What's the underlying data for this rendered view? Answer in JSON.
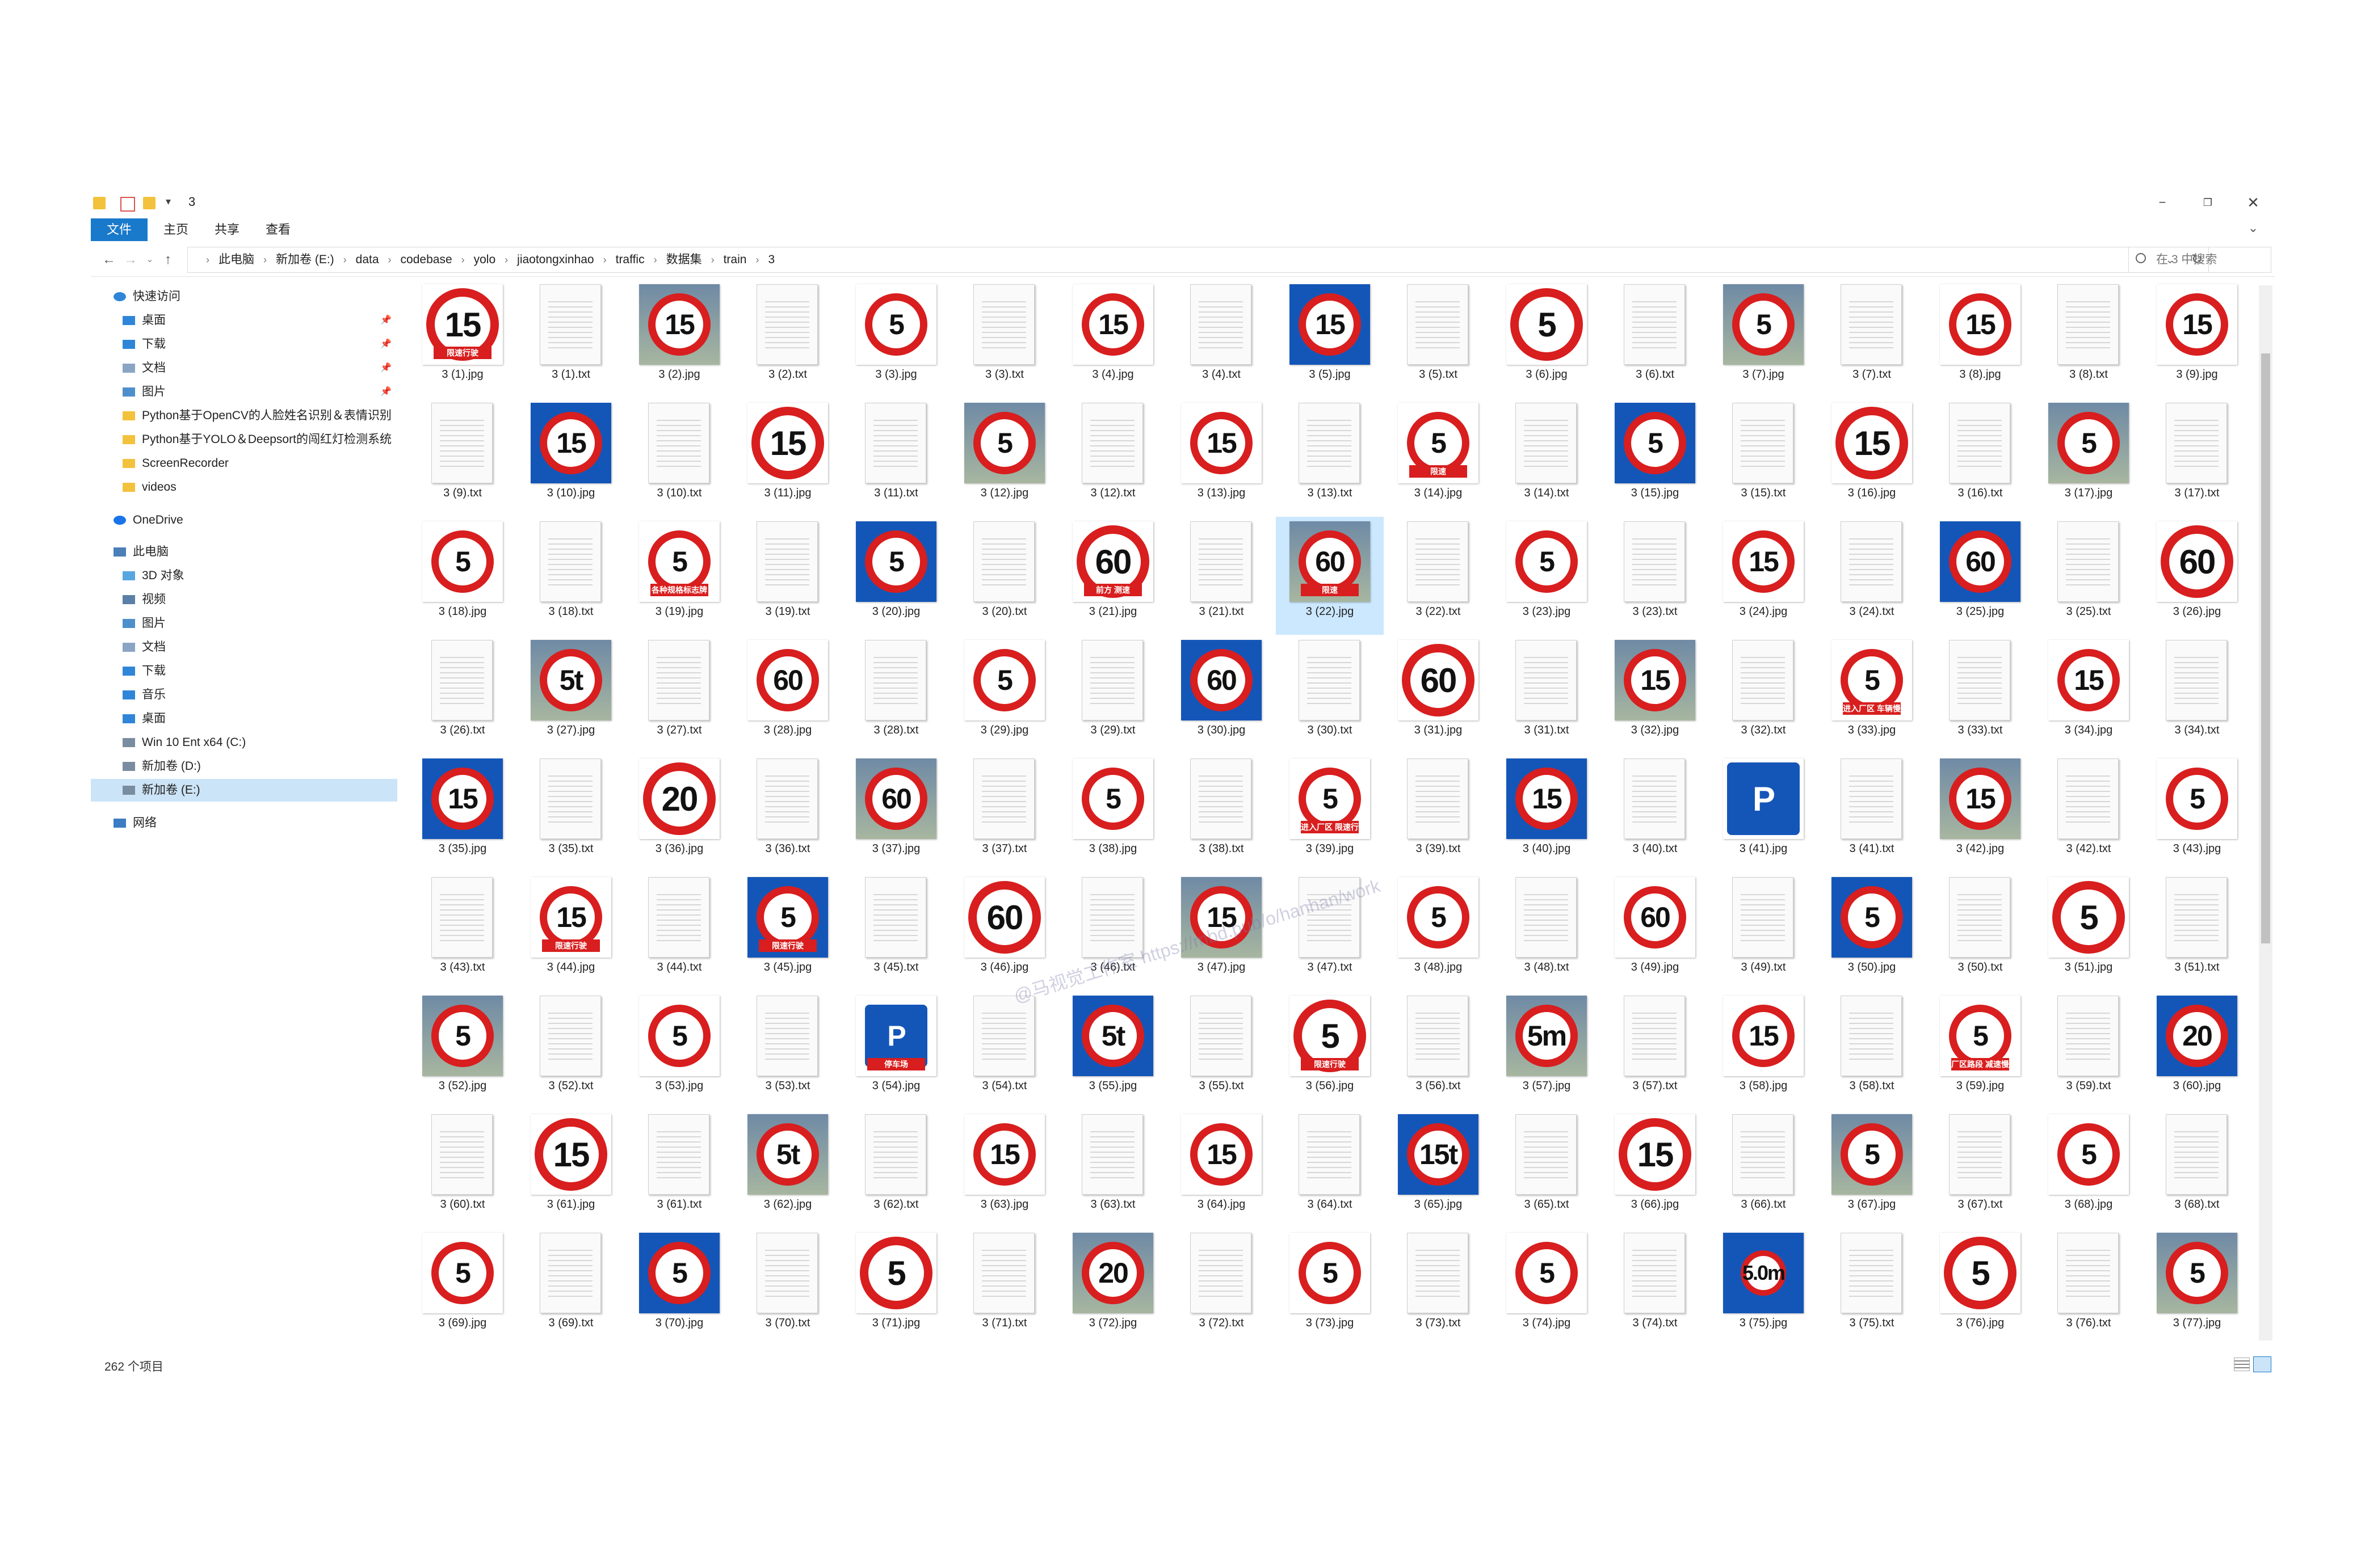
{
  "window": {
    "title": "3",
    "minimize": "−",
    "maximize": "❐",
    "close": "✕"
  },
  "ribbon": {
    "tabs": [
      "文件",
      "主页",
      "共享",
      "查看"
    ],
    "expand": "⌄"
  },
  "nav": {
    "back": "←",
    "forward": "→",
    "recent": "⌄",
    "up": "↑"
  },
  "address": {
    "crumbs": [
      "此电脑",
      "新加卷 (E:)",
      "data",
      "codebase",
      "yolo",
      "jiaotongxinhao",
      "traffic",
      "数据集",
      "train",
      "3"
    ],
    "dropdown": "⌄",
    "refresh": "↻"
  },
  "search": {
    "placeholder": "在 3 中搜索"
  },
  "navpane": {
    "items": [
      {
        "label": "快速访问",
        "level": 0,
        "icon": "star-icon",
        "pinned": false,
        "selected": false
      },
      {
        "label": "桌面",
        "level": 1,
        "icon": "desktop-icon",
        "pinned": true,
        "selected": false
      },
      {
        "label": "下载",
        "level": 1,
        "icon": "download-icon",
        "pinned": true,
        "selected": false
      },
      {
        "label": "文档",
        "level": 1,
        "icon": "document-icon",
        "pinned": true,
        "selected": false
      },
      {
        "label": "图片",
        "level": 1,
        "icon": "picture-icon",
        "pinned": true,
        "selected": false
      },
      {
        "label": "Python基于OpenCV的人脸姓名识别＆表情识别",
        "level": 1,
        "icon": "folder-icon",
        "pinned": false,
        "selected": false
      },
      {
        "label": "Python基于YOLO＆Deepsort的闯红灯检测系统",
        "level": 1,
        "icon": "folder-icon",
        "pinned": false,
        "selected": false
      },
      {
        "label": "ScreenRecorder",
        "level": 1,
        "icon": "folder-icon",
        "pinned": false,
        "selected": false
      },
      {
        "label": "videos",
        "level": 1,
        "icon": "folder-icon",
        "pinned": false,
        "selected": false
      },
      {
        "label": "OneDrive",
        "level": 0,
        "icon": "cloud-icon",
        "pinned": false,
        "selected": false
      },
      {
        "label": "此电脑",
        "level": 0,
        "icon": "computer-icon",
        "pinned": false,
        "selected": false
      },
      {
        "label": "3D 对象",
        "level": 1,
        "icon": "cube-icon",
        "pinned": false,
        "selected": false
      },
      {
        "label": "视频",
        "level": 1,
        "icon": "video-icon",
        "pinned": false,
        "selected": false
      },
      {
        "label": "图片",
        "level": 1,
        "icon": "picture-icon",
        "pinned": false,
        "selected": false
      },
      {
        "label": "文档",
        "level": 1,
        "icon": "document-icon",
        "pinned": false,
        "selected": false
      },
      {
        "label": "下载",
        "level": 1,
        "icon": "download-icon",
        "pinned": false,
        "selected": false
      },
      {
        "label": "音乐",
        "level": 1,
        "icon": "music-icon",
        "pinned": false,
        "selected": false
      },
      {
        "label": "桌面",
        "level": 1,
        "icon": "desktop-icon",
        "pinned": false,
        "selected": false
      },
      {
        "label": "Win 10 Ent x64 (C:)",
        "level": 1,
        "icon": "drive-icon",
        "pinned": false,
        "selected": false
      },
      {
        "label": "新加卷 (D:)",
        "level": 1,
        "icon": "drive-icon",
        "pinned": false,
        "selected": false
      },
      {
        "label": "新加卷 (E:)",
        "level": 1,
        "icon": "drive-icon",
        "pinned": false,
        "selected": true
      },
      {
        "label": "网络",
        "level": 0,
        "icon": "network-icon",
        "pinned": false,
        "selected": false
      }
    ],
    "pin_glyph": "📌"
  },
  "files": [
    "3 (1).jpg",
    "3 (1).txt",
    "3 (2).jpg",
    "3 (2).txt",
    "3 (3).jpg",
    "3 (3).txt",
    "3 (4).jpg",
    "3 (4).txt",
    "3 (5).jpg",
    "3 (5).txt",
    "3 (6).jpg",
    "3 (6).txt",
    "3 (7).jpg",
    "3 (7).txt",
    "3 (8).jpg",
    "3 (8).txt",
    "3 (9).jpg",
    "3 (9).txt",
    "3 (10).jpg",
    "3 (10).txt",
    "3 (11).jpg",
    "3 (11).txt",
    "3 (12).jpg",
    "3 (12).txt",
    "3 (13).jpg",
    "3 (13).txt",
    "3 (14).jpg",
    "3 (14).txt",
    "3 (15).jpg",
    "3 (15).txt",
    "3 (16).jpg",
    "3 (16).txt",
    "3 (17).jpg",
    "3 (17).txt",
    "3 (18).jpg",
    "3 (18).txt",
    "3 (19).jpg",
    "3 (19).txt",
    "3 (20).jpg",
    "3 (20).txt",
    "3 (21).jpg",
    "3 (21).txt",
    "3 (22).jpg",
    "3 (22).txt",
    "3 (23).jpg",
    "3 (23).txt",
    "3 (24).jpg",
    "3 (24).txt",
    "3 (25).jpg",
    "3 (25).txt",
    "3 (26).jpg",
    "3 (26).txt",
    "3 (27).jpg",
    "3 (27).txt",
    "3 (28).jpg",
    "3 (28).txt",
    "3 (29).jpg",
    "3 (29).txt",
    "3 (30).jpg",
    "3 (30).txt",
    "3 (31).jpg",
    "3 (31).txt",
    "3 (32).jpg",
    "3 (32).txt",
    "3 (33).jpg",
    "3 (33).txt",
    "3 (34).jpg",
    "3 (34).txt",
    "3 (35).jpg",
    "3 (35).txt",
    "3 (36).jpg",
    "3 (36).txt",
    "3 (37).jpg",
    "3 (37).txt",
    "3 (38).jpg",
    "3 (38).txt",
    "3 (39).jpg",
    "3 (39).txt",
    "3 (40).jpg",
    "3 (40).txt",
    "3 (41).jpg",
    "3 (41).txt",
    "3 (42).jpg",
    "3 (42).txt",
    "3 (43).jpg",
    "3 (43).txt",
    "3 (44).jpg",
    "3 (44).txt",
    "3 (45).jpg",
    "3 (45).txt",
    "3 (46).jpg",
    "3 (46).txt",
    "3 (47).jpg",
    "3 (47).txt",
    "3 (48).jpg",
    "3 (48).txt",
    "3 (49).jpg",
    "3 (49).txt",
    "3 (50).jpg",
    "3 (50).txt",
    "3 (51).jpg",
    "3 (51).txt",
    "3 (52).jpg",
    "3 (52).txt",
    "3 (53).jpg",
    "3 (53).txt",
    "3 (54).jpg",
    "3 (54).txt",
    "3 (55).jpg",
    "3 (55).txt",
    "3 (56).jpg",
    "3 (56).txt",
    "3 (57).jpg",
    "3 (57).txt",
    "3 (58).jpg",
    "3 (58).txt",
    "3 (59).jpg",
    "3 (59).txt",
    "3 (60).jpg",
    "3 (60).txt",
    "3 (61).jpg",
    "3 (61).txt",
    "3 (62).jpg",
    "3 (62).txt",
    "3 (63).jpg",
    "3 (63).txt",
    "3 (64).jpg",
    "3 (64).txt",
    "3 (65).jpg",
    "3 (65).txt",
    "3 (66).jpg",
    "3 (66).txt",
    "3 (67).jpg",
    "3 (67).txt",
    "3 (68).jpg",
    "3 (68).txt",
    "3 (69).jpg",
    "3 (69).txt",
    "3 (70).jpg",
    "3 (70).txt",
    "3 (71).jpg",
    "3 (71).txt",
    "3 (72).jpg",
    "3 (72).txt",
    "3 (73).jpg",
    "3 (73).txt",
    "3 (74).jpg",
    "3 (74).txt",
    "3 (75).jpg",
    "3 (75).txt",
    "3 (76).jpg",
    "3 (76).txt",
    "3 (77).jpg",
    "3 (77).txt"
  ],
  "selected_file": "3 (22).jpg",
  "thumb_numbers": {
    "3 (1).jpg": "15",
    "3 (2).jpg": "15",
    "3 (3).jpg": "5",
    "3 (4).jpg": "15",
    "3 (5).jpg": "15",
    "3 (6).jpg": "5",
    "3 (7).jpg": "5",
    "3 (8).jpg": "15",
    "3 (9).jpg": "15",
    "3 (10).jpg": "15",
    "3 (11).jpg": "15",
    "3 (12).jpg": "5",
    "3 (13).jpg": "15",
    "3 (14).jpg": "5",
    "3 (15).jpg": "5",
    "3 (16).jpg": "15",
    "3 (17).jpg": "5",
    "3 (18).jpg": "5",
    "3 (19).jpg": "5",
    "3 (20).jpg": "5",
    "3 (21).jpg": "60",
    "3 (22).jpg": "60",
    "3 (23).jpg": "5",
    "3 (24).jpg": "15",
    "3 (25).jpg": "60",
    "3 (26).jpg": "60",
    "3 (27).jpg": "5t",
    "3 (28).jpg": "60",
    "3 (29).jpg": "5",
    "3 (30).jpg": "60",
    "3 (31).jpg": "60",
    "3 (32).jpg": "15",
    "3 (33).jpg": "5",
    "3 (34).jpg": "15",
    "3 (35).jpg": "15",
    "3 (36).jpg": "20",
    "3 (37).jpg": "60",
    "3 (38).jpg": "5",
    "3 (39).jpg": "5",
    "3 (40).jpg": "15",
    "3 (41).jpg": "P",
    "3 (42).jpg": "15",
    "3 (43).jpg": "5",
    "3 (44).jpg": "15",
    "3 (45).jpg": "5",
    "3 (46).jpg": "60",
    "3 (47).jpg": "15",
    "3 (48).jpg": "5",
    "3 (49).jpg": "60",
    "3 (50).jpg": "5",
    "3 (51).jpg": "5",
    "3 (52).jpg": "5",
    "3 (53).jpg": "5",
    "3 (54).jpg": "P",
    "3 (55).jpg": "5t",
    "3 (56).jpg": "5",
    "3 (57).jpg": "5m",
    "3 (58).jpg": "15",
    "3 (59).jpg": "5",
    "3 (60).jpg": "20",
    "3 (61).jpg": "15",
    "3 (62).jpg": "5t",
    "3 (63).jpg": "15",
    "3 (64).jpg": "15",
    "3 (65).jpg": "15t",
    "3 (66).jpg": "15",
    "3 (67).jpg": "5",
    "3 (68).jpg": "5",
    "3 (69).jpg": "5",
    "3 (70).jpg": "5",
    "3 (71).jpg": "5",
    "3 (72).jpg": "20",
    "3 (73).jpg": "5",
    "3 (74).jpg": "5",
    "3 (75).jpg": "5.0m",
    "3 (76).jpg": "5",
    "3 (77).jpg": "5"
  },
  "thumb_labels": {
    "3 (1).jpg": "限速行驶",
    "3 (44).jpg": "限速行驶",
    "3 (45).jpg": "限速行驶",
    "3 (56).jpg": "限速行驶",
    "3 (21).jpg": "前方 测速",
    "3 (22).jpg": "限速",
    "3 (14).jpg": "限速",
    "3 (54).jpg": "停车场",
    "3 (39).jpg": "进入厂区 限速行驶",
    "3 (33).jpg": "进入厂区 车辆慢行",
    "3 (59).jpg": "厂区路段 减速慢行",
    "3 (19).jpg": "各种规格标志牌"
  },
  "status": {
    "count": "262 个项目"
  },
  "watermark": "@马视觉工作室  https://mbd.pub/o/hanhan/work"
}
